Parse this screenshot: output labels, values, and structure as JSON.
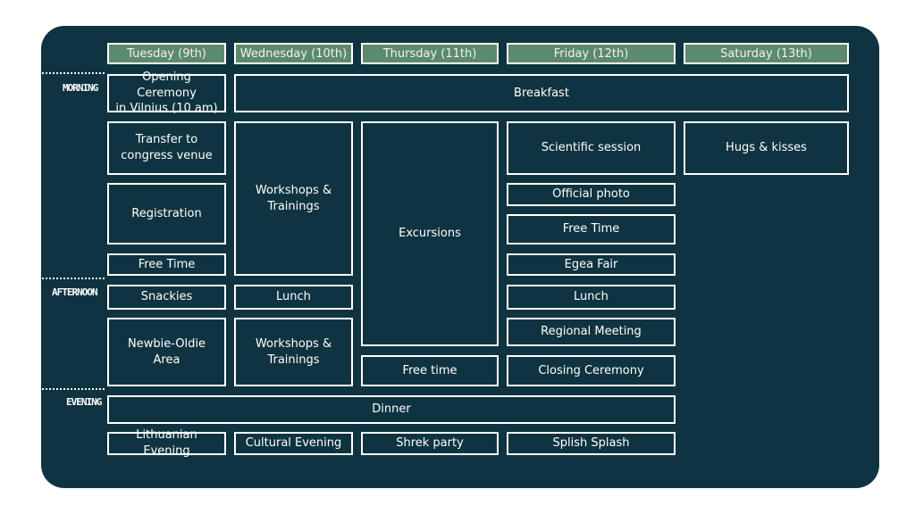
{
  "days": [
    "Tuesday (9th)",
    "Wednesday (10th)",
    "Thursday (11th)",
    "Friday (12th)",
    "Saturday (13th)"
  ],
  "slots": [
    "Morning",
    "Afternoon",
    "Evening"
  ],
  "events": {
    "opening_ceremony": "Opening Ceremony\nin Vilnius (10 am)",
    "breakfast": "Breakfast",
    "transfer": "Transfer to\ncongress venue",
    "registration": "Registration",
    "free_time_tue": "Free Time",
    "snackies": "Snackies",
    "newbie_oldie": "Newbie-Oldie\nArea",
    "workshops_1": "Workshops &\nTrainings",
    "lunch_wed": "Lunch",
    "workshops_2": "Workshops &\nTrainings",
    "excursions": "Excursions",
    "free_time_thu": "Free time",
    "scientific_session": "Scientific session",
    "official_photo": "Official photo",
    "free_time_fri": "Free Time",
    "egea_fair": "Egea Fair",
    "lunch_fri": "Lunch",
    "regional_meeting": "Regional Meeting",
    "closing_ceremony": "Closing Ceremony",
    "hugs_kisses": "Hugs & kisses",
    "dinner": "Dinner",
    "lithuanian_evening": "Lithuanian Evening",
    "cultural_evening": "Cultural Evening",
    "shrek_party": "Shrek party",
    "splish_splash": "Splish Splash"
  }
}
